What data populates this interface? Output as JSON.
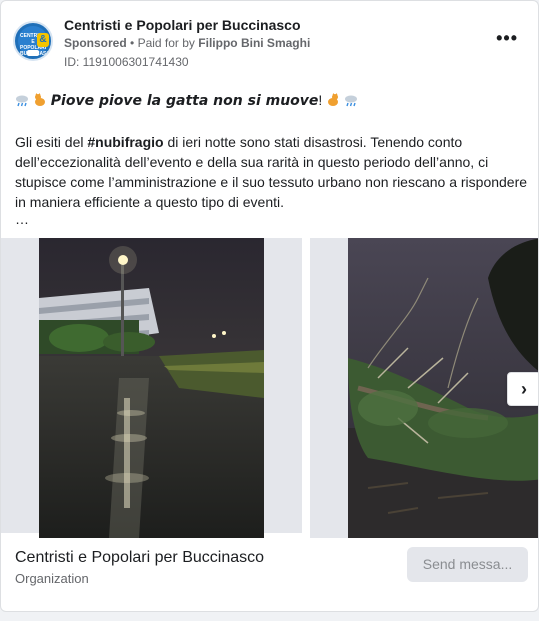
{
  "page": {
    "name": "Centristi e Popolari per Buccinasco",
    "sponsored": "Sponsored",
    "separator": "•",
    "paid_for_prefix": "Paid for by",
    "paid_for_name": "Filippo Bini Smaghi",
    "ad_id": "ID: 1191006301741430",
    "avatar_text": "CENTRISTI E POPOLARI BUCCINASCO",
    "avatar_symbol": "&"
  },
  "post": {
    "headline": "Piove piove la gatta non si muove",
    "headline_bang": "!",
    "body_part1": "Gli esiti del ",
    "hashtag": "#nubifragio",
    "body_part2": " di ieri notte sono stati disastrosi. Tenendo conto dell’eccezionalità dell’evento e della sua rarità in questo periodo dell’anno, ci stupisce come l’amministrazione e il suo tessuto urbano non riescano a rispondere in maniera efficiente a questo tipo di eventi.",
    "ellipsis": "…",
    "emoji_icons": [
      "rain-cloud-icon",
      "cat-icon"
    ]
  },
  "carousel": {
    "next_symbol": "›",
    "slides": [
      {
        "description": "flooded street at night"
      },
      {
        "description": "fallen tree at night"
      }
    ]
  },
  "footer": {
    "name": "Centristi e Popolari per Buccinasco",
    "category": "Organization",
    "send_label": "Send messa..."
  },
  "colors": {
    "secondary_text": "#65676b",
    "button_bg": "#e4e6eb",
    "brand_blue": "#1f6fb8",
    "brand_yellow": "#f5c400"
  }
}
